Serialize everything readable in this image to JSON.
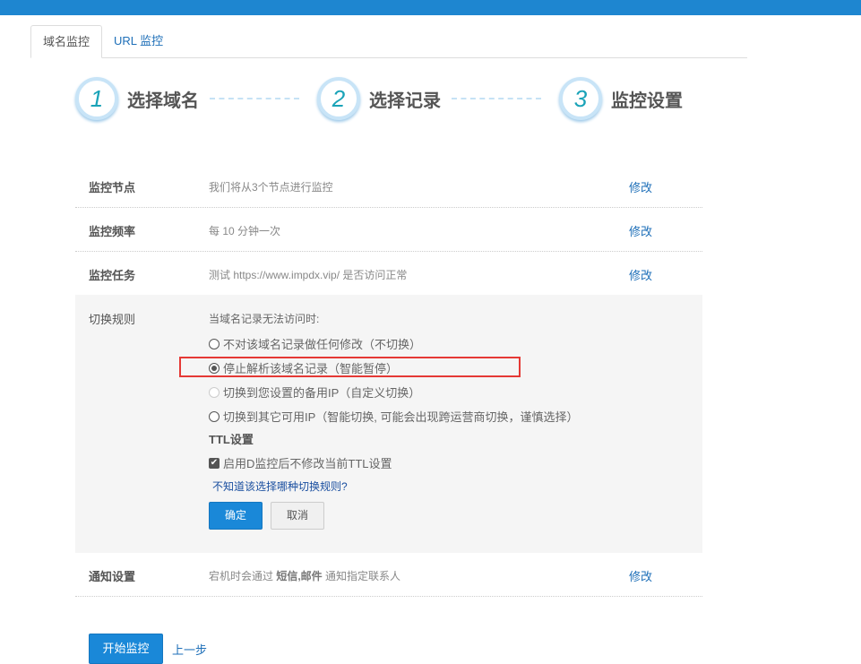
{
  "tabs": [
    {
      "label": "域名监控"
    },
    {
      "label": "URL 监控"
    }
  ],
  "steps": [
    {
      "num": "1",
      "label": "选择域名"
    },
    {
      "num": "2",
      "label": "选择记录"
    },
    {
      "num": "3",
      "label": "监控设置"
    }
  ],
  "rows": [
    {
      "label": "监控节点",
      "value": "我们将从3个节点进行监控",
      "edit": "修改"
    },
    {
      "label": "监控频率",
      "value": "每 10 分钟一次",
      "edit": "修改"
    },
    {
      "label": "监控任务",
      "value": "测试 https://www.impdx.vip/ 是否访问正常",
      "edit": "修改"
    }
  ],
  "switch_rule": {
    "label": "切换规则",
    "prompt": "当域名记录无法访问时:",
    "options": [
      {
        "label": "不对该域名记录做任何修改（不切换）",
        "state": "unchecked"
      },
      {
        "label": "停止解析该域名记录（智能暂停）",
        "state": "checked"
      },
      {
        "label": "切换到您设置的备用IP（自定义切换）",
        "state": "disabled"
      },
      {
        "label": "切换到其它可用IP（智能切换, 可能会出现跨运营商切换，谨慎选择）",
        "state": "unchecked"
      }
    ],
    "ttl_title": "TTL设置",
    "ttl_checkbox": "启用D监控后不修改当前TTL设置",
    "help_link": "不知道该选择哪种切换规则?",
    "confirm": "确定",
    "cancel": "取消"
  },
  "notify": {
    "label": "通知设置",
    "prefix": "宕机时会通过 ",
    "methods": "短信,邮件",
    "suffix": " 通知指定联系人",
    "edit": "修改"
  },
  "footer": {
    "start": "开始监控",
    "prev": "上一步"
  }
}
